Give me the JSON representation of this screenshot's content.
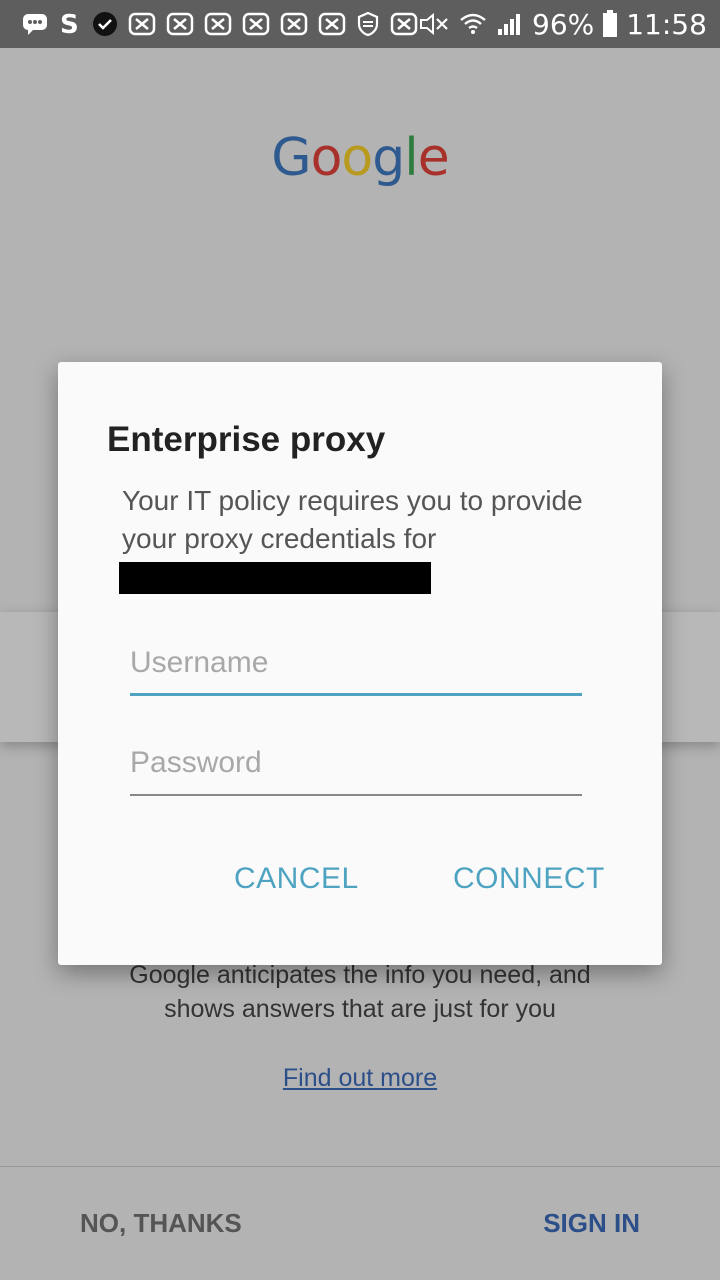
{
  "status_bar": {
    "battery": "96%",
    "time": "11:58"
  },
  "background": {
    "logo": {
      "letters": [
        "G",
        "o",
        "o",
        "g",
        "l",
        "e"
      ]
    },
    "description_line1": "Google anticipates the info you need, and",
    "description_line2": "shows answers that are just for you",
    "link": "Find out more",
    "bottom": {
      "no_thanks": "NO, THANKS",
      "sign_in": "SIGN IN"
    }
  },
  "dialog": {
    "title": "Enterprise proxy",
    "message": "Your IT policy requires you to provide your proxy credentials for",
    "username": {
      "value": "",
      "placeholder": "Username"
    },
    "password": {
      "value": "",
      "placeholder": "Password"
    },
    "cancel_label": "CANCEL",
    "connect_label": "CONNECT"
  },
  "colors": {
    "accent": "#4ea3c1",
    "status_bar": "#5e5e5e",
    "scrim": "#b3b3b3",
    "link": "#2c4f8a"
  },
  "icons": [
    "message-icon",
    "s-app-icon",
    "check-circle-icon",
    "notification-icon",
    "shield-icon",
    "mute-icon",
    "wifi-icon",
    "signal-icon",
    "battery-icon"
  ]
}
